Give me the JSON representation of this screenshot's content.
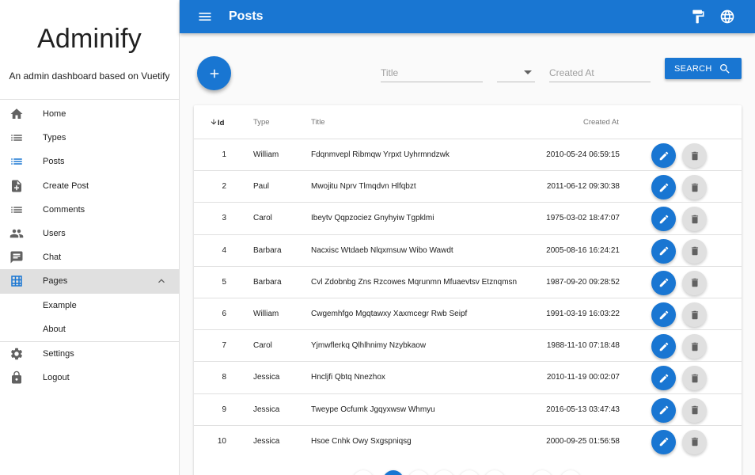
{
  "brand": {
    "title": "Adminify",
    "subtitle": "An admin dashboard based on Vuetify"
  },
  "sidebar": {
    "items": [
      {
        "label": "Home",
        "icon": "home-icon"
      },
      {
        "label": "Types",
        "icon": "list-icon"
      },
      {
        "label": "Posts",
        "icon": "list-icon",
        "active": true
      },
      {
        "label": "Create Post",
        "icon": "note-add-icon"
      },
      {
        "label": "Comments",
        "icon": "list-icon"
      },
      {
        "label": "Users",
        "icon": "people-icon"
      },
      {
        "label": "Chat",
        "icon": "chat-icon"
      },
      {
        "label": "Pages",
        "icon": "grid-icon",
        "expanded": true
      },
      {
        "label": "Example",
        "icon": ""
      },
      {
        "label": "About",
        "icon": ""
      },
      {
        "label": "Settings",
        "icon": "gear-icon"
      },
      {
        "label": "Logout",
        "icon": "lock-icon"
      }
    ]
  },
  "header": {
    "title": "Posts"
  },
  "filters": {
    "title_placeholder": "Title",
    "created_at_placeholder": "Created At",
    "search_label": "SEARCH"
  },
  "table": {
    "columns": {
      "id": "Id",
      "type": "Type",
      "title": "Title",
      "created_at": "Created At"
    },
    "rows": [
      {
        "id": "1",
        "type": "William",
        "title": "Fdqnmvepl Ribmqw Yrpxt Uyhrmndzwk",
        "created_at": "2010-05-24 06:59:15"
      },
      {
        "id": "2",
        "type": "Paul",
        "title": "Mwojitu Nprv Tlmqdvn Hlfqbzt",
        "created_at": "2011-06-12 09:30:38"
      },
      {
        "id": "3",
        "type": "Carol",
        "title": "Ibeytv Qqpzociez Gnyhyiw Tgpklmi",
        "created_at": "1975-03-02 18:47:07"
      },
      {
        "id": "4",
        "type": "Barbara",
        "title": "Nacxisc Wtdaeb Nlqxmsuw Wibo Wawdt",
        "created_at": "2005-08-16 16:24:21"
      },
      {
        "id": "5",
        "type": "Barbara",
        "title": "Cvl Zdobnbg Zns Rzcowes Mqrunmn Mfuaevtsv Etznqmsn",
        "created_at": "1987-09-20 09:28:52"
      },
      {
        "id": "6",
        "type": "William",
        "title": "Cwgemhfgo Mgqtawxy Xaxmcegr Rwb Seipf",
        "created_at": "1991-03-19 16:03:22"
      },
      {
        "id": "7",
        "type": "Carol",
        "title": "Yjmwflerkq Qlhlhnimy Nzybkaow",
        "created_at": "1988-11-10 07:18:48"
      },
      {
        "id": "8",
        "type": "Jessica",
        "title": "Hncljfi Qbtq Nnezhox",
        "created_at": "2010-11-19 00:02:07"
      },
      {
        "id": "9",
        "type": "Jessica",
        "title": "Tweype Ocfumk Jgqyxwsw Whmyu",
        "created_at": "2016-05-13 03:47:43"
      },
      {
        "id": "10",
        "type": "Jessica",
        "title": "Hsoe Cnhk Owy Sxgspniqsg",
        "created_at": "2000-09-25 01:56:58"
      }
    ]
  },
  "colors": {
    "primary": "#1976d2",
    "sidebar_active_bg": "#e0e0e0",
    "delete_button": "#e0e0e0"
  }
}
